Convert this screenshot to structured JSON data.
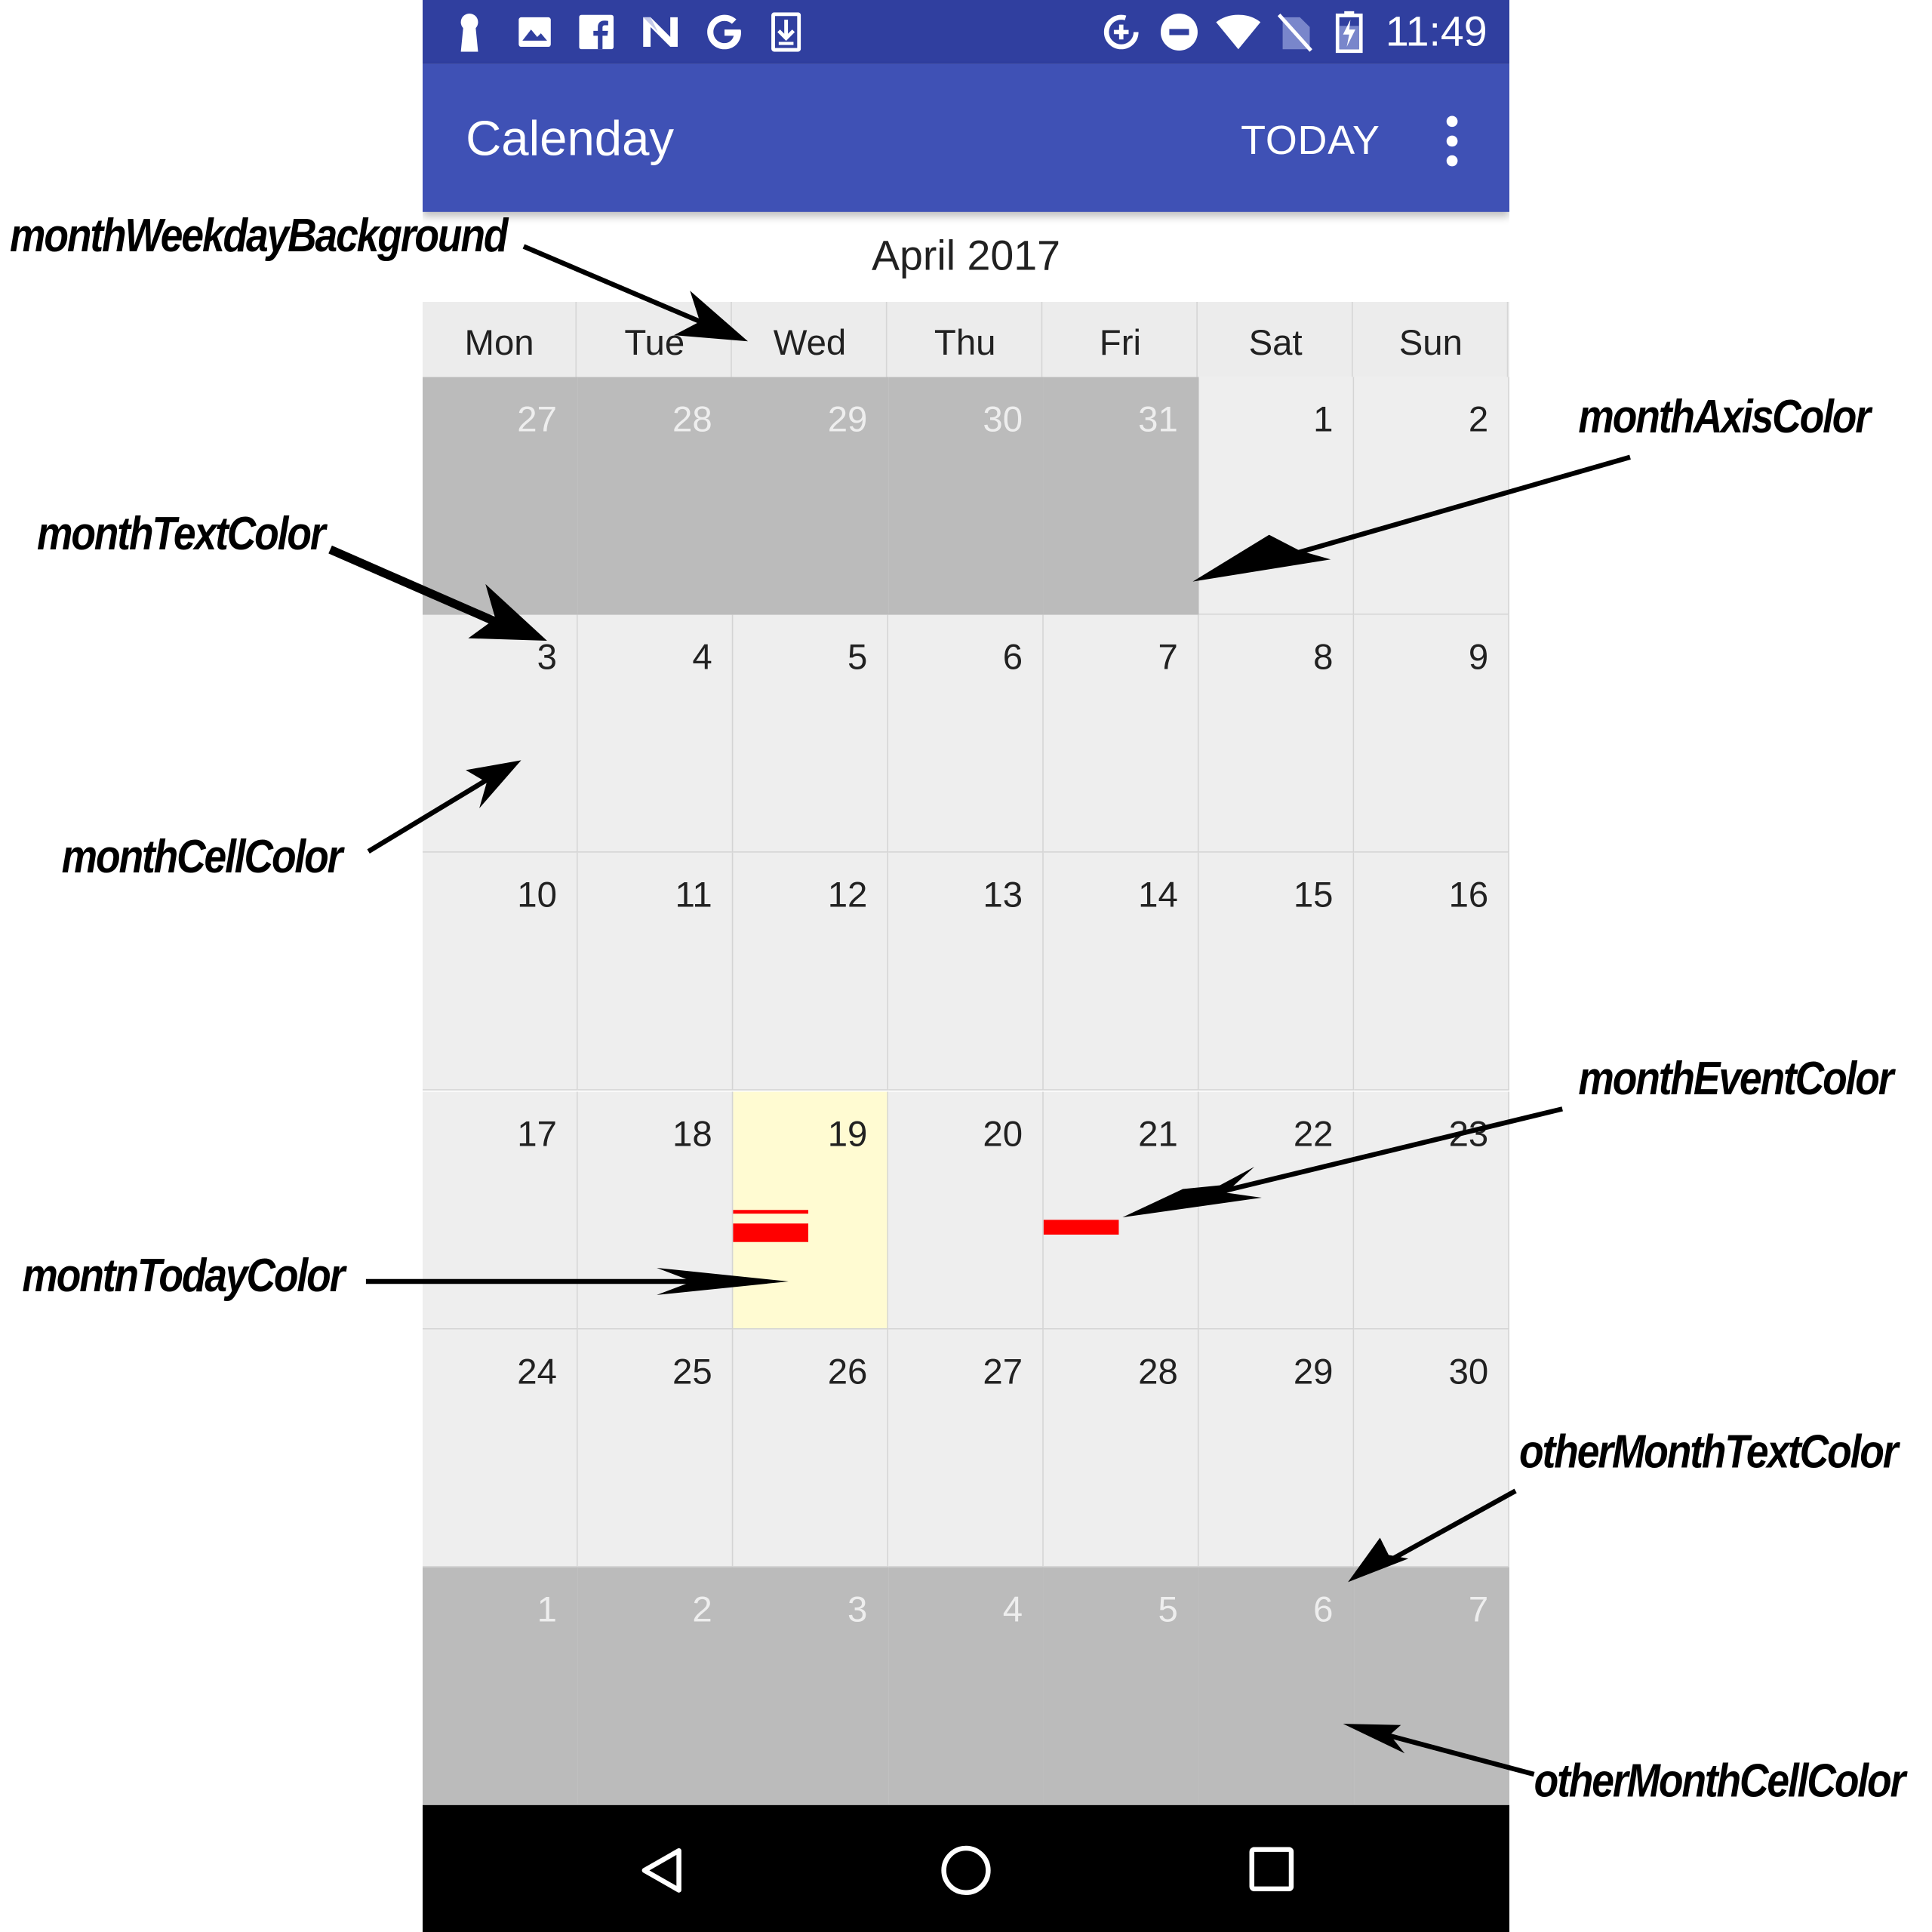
{
  "status_bar": {
    "time": "11:49",
    "left_icons": [
      "keyhole-icon",
      "image-icon",
      "facebook-icon",
      "n-logo-icon",
      "google-icon",
      "download-icon"
    ],
    "right_icons": [
      "data-saver-icon",
      "do-not-disturb-icon",
      "wifi-icon",
      "no-sim-icon",
      "battery-charging-icon"
    ]
  },
  "app_bar": {
    "title": "Calenday",
    "today_label": "TODAY",
    "overflow_icon": "more-vert-icon",
    "color": "#3f51b5",
    "status_color": "#303f9f"
  },
  "calendar": {
    "month_label": "April 2017",
    "weekdays": [
      "Mon",
      "Tue",
      "Wed",
      "Thu",
      "Fri",
      "Sat",
      "Sun"
    ],
    "weeks": [
      [
        {
          "d": "27",
          "other": true
        },
        {
          "d": "28",
          "other": true
        },
        {
          "d": "29",
          "other": true
        },
        {
          "d": "30",
          "other": true
        },
        {
          "d": "31",
          "other": true
        },
        {
          "d": "1"
        },
        {
          "d": "2"
        }
      ],
      [
        {
          "d": "3"
        },
        {
          "d": "4"
        },
        {
          "d": "5"
        },
        {
          "d": "6"
        },
        {
          "d": "7"
        },
        {
          "d": "8"
        },
        {
          "d": "9"
        }
      ],
      [
        {
          "d": "10"
        },
        {
          "d": "11"
        },
        {
          "d": "12"
        },
        {
          "d": "13"
        },
        {
          "d": "14"
        },
        {
          "d": "15"
        },
        {
          "d": "16"
        }
      ],
      [
        {
          "d": "17"
        },
        {
          "d": "18"
        },
        {
          "d": "19",
          "today": true,
          "events": 2
        },
        {
          "d": "20"
        },
        {
          "d": "21",
          "events": 1
        },
        {
          "d": "22"
        },
        {
          "d": "23"
        }
      ],
      [
        {
          "d": "24"
        },
        {
          "d": "25"
        },
        {
          "d": "26"
        },
        {
          "d": "27"
        },
        {
          "d": "28"
        },
        {
          "d": "29"
        },
        {
          "d": "30"
        }
      ],
      [
        {
          "d": "1",
          "other": true
        },
        {
          "d": "2",
          "other": true
        },
        {
          "d": "3",
          "other": true
        },
        {
          "d": "4",
          "other": true
        },
        {
          "d": "5",
          "other": true
        },
        {
          "d": "6",
          "other": true
        },
        {
          "d": "7",
          "other": true
        }
      ]
    ],
    "colors": {
      "weekday_background": "#ececec",
      "cell": "#eeeeee",
      "other_month_cell": "#bbbbbb",
      "other_month_text": "#eeeeee",
      "text": "#212121",
      "today": "#fffbd2",
      "event": "#ff0000",
      "axis": "#d4d4d4"
    }
  },
  "nav_bar": {
    "back_icon": "back-triangle-icon",
    "home_icon": "home-circle-icon",
    "recents_icon": "recents-square-icon"
  },
  "annotations": {
    "month_weekday_background": "monthWeekdayBackground",
    "month_axis_color": "monthAxisColor",
    "month_text_color": "monthTextColor",
    "month_cell_color": "monthCellColor",
    "month_event_color": "monthEventColor",
    "month_today_color": "montnTodayColor",
    "other_month_text_color": "otherMonthTextColor",
    "other_month_cell_color": "otherMonthCellColor"
  }
}
